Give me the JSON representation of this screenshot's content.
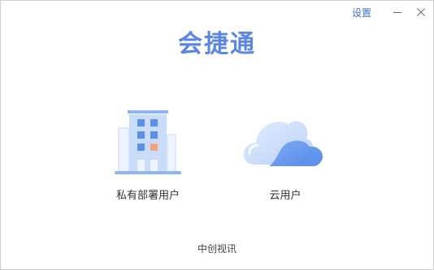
{
  "titlebar": {
    "settings_label": "设置",
    "minimize_icon": "minimize-icon",
    "close_icon": "close-icon"
  },
  "app": {
    "title": "会捷通",
    "title_color": "#5b86e4"
  },
  "options": [
    {
      "label": "私有部署用户",
      "icon": "building-icon"
    },
    {
      "label": "云用户",
      "icon": "cloud-icon"
    }
  ],
  "footer": {
    "company": "中创视讯"
  },
  "colors": {
    "accent": "#3b6fd8",
    "icon_blue": "#5b8fe8",
    "icon_light": "#c9dcfa",
    "highlight_orange": "#f4a27a"
  }
}
